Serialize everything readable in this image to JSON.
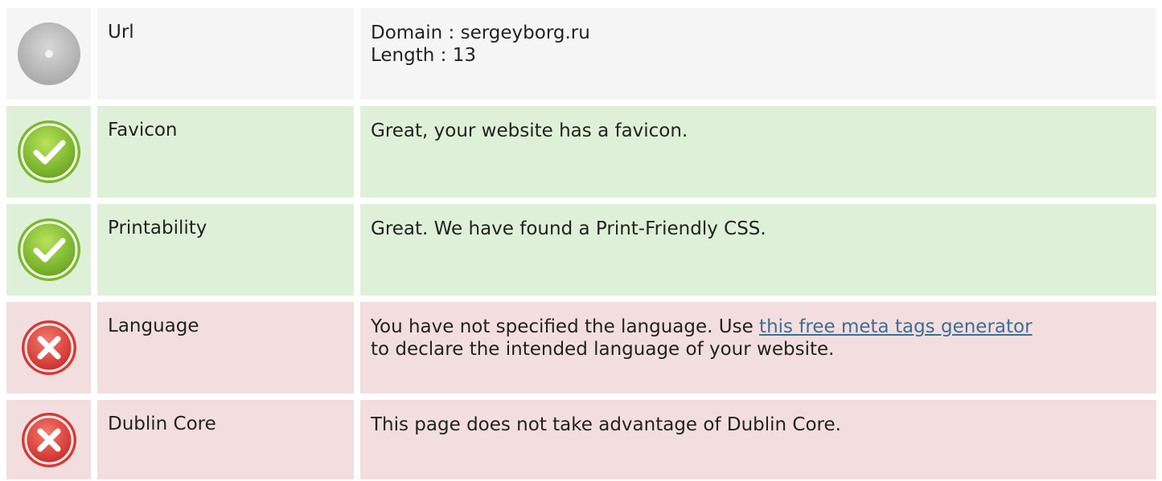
{
  "rows": [
    {
      "status": "neutral",
      "icon": "neutral-dot-icon",
      "label": "Url",
      "value_lines": [
        "Domain : sergeyborg.ru",
        "Length : 13"
      ]
    },
    {
      "status": "good",
      "icon": "check-icon",
      "label": "Favicon",
      "value": "Great, your website has a favicon."
    },
    {
      "status": "good",
      "icon": "check-icon",
      "label": "Printability",
      "value": "Great. We have found a Print-Friendly CSS."
    },
    {
      "status": "bad",
      "icon": "cross-icon",
      "label": "Language",
      "value_before_link": "You have not specified the language. Use ",
      "link_text": "this free meta tags generator",
      "value_after_link": "to declare the intended language of your website."
    },
    {
      "status": "bad",
      "icon": "cross-icon",
      "label": "Dublin Core",
      "value": "This page does not take advantage of Dublin Core."
    }
  ],
  "colors": {
    "neutral_bg": "#f5f5f5",
    "good_bg": "#dff0d8",
    "bad_bg": "#f2dede",
    "link": "#3d6d96",
    "check_green": "#8cc63f",
    "cross_red": "#e0403f"
  }
}
